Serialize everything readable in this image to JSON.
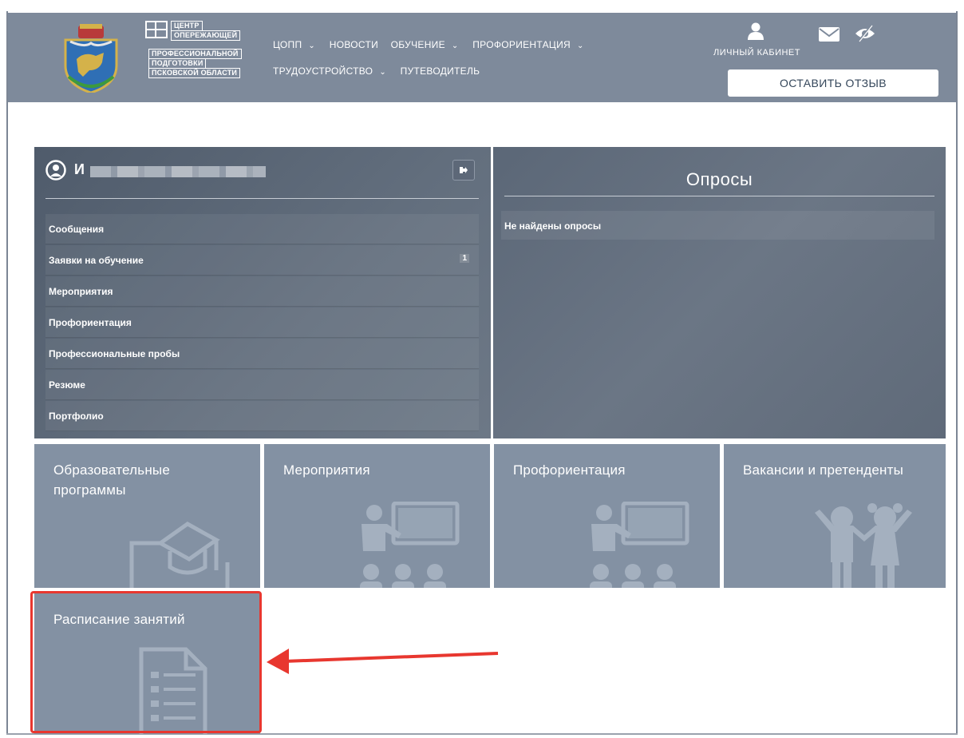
{
  "header": {
    "logo_lines": [
      "ЦЕНТР",
      "ОПЕРЕЖАЮЩЕЙ",
      "ПРОФЕССИОНАЛЬНОЙ",
      "ПОДГОТОВКИ",
      "ПСКОВСКОЙ ОБЛАСТИ"
    ],
    "nav_row1": [
      {
        "label": "ЦОПП",
        "has_dropdown": true
      },
      {
        "label": "НОВОСТИ",
        "has_dropdown": false
      },
      {
        "label": "ОБУЧЕНИЕ",
        "has_dropdown": true
      },
      {
        "label": "ПРОФОРИЕНТАЦИЯ",
        "has_dropdown": true
      }
    ],
    "nav_row2": [
      {
        "label": "ТРУДОУСТРОЙСТВО",
        "has_dropdown": true
      },
      {
        "label": "ПУТЕВОДИТЕЛЬ",
        "has_dropdown": false
      }
    ],
    "dropdown_glyph": "⌄",
    "cabinet_label": "ЛИЧНЫЙ КАБИНЕТ",
    "feedback_button": "ОСТАВИТЬ ОТЗЫВ",
    "icons": [
      "user-icon",
      "mail-icon",
      "low-vision-icon"
    ]
  },
  "profile": {
    "name_initial": "И",
    "logout_icon": "logout-icon",
    "menu": [
      {
        "label": "Сообщения",
        "count": ""
      },
      {
        "label": "Заявки на обучение",
        "count": "1"
      },
      {
        "label": "Мероприятия",
        "count": ""
      },
      {
        "label": "Профориентация",
        "count": ""
      },
      {
        "label": "Профессиональные пробы",
        "count": ""
      },
      {
        "label": "Резюме",
        "count": ""
      },
      {
        "label": "Портфолио",
        "count": ""
      }
    ]
  },
  "surveys": {
    "title": "Опросы",
    "empty_text": "Не найдены опросы"
  },
  "tiles": {
    "education": "Образовательные программы",
    "events": "Мероприятия",
    "career": "Профориентация",
    "vacancies": "Вакансии и претенденты",
    "schedule": "Расписание занятий"
  },
  "colors": {
    "header_bg": "#7e8a9b",
    "tile_bg": "#8391a3",
    "panel_dark": "#55616f",
    "highlight": "#e8372f"
  }
}
